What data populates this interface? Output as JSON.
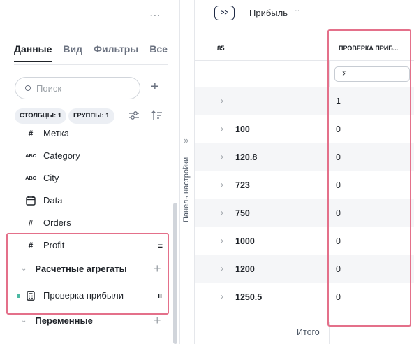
{
  "left_panel": {
    "more_label": "⋯",
    "tabs": [
      {
        "label": "Данные"
      },
      {
        "label": "Вид"
      },
      {
        "label": "Фильтры"
      },
      {
        "label": "Все"
      }
    ],
    "search": {
      "placeholder": "Поиск"
    },
    "chips": {
      "columns": "СТОЛБЦЫ: 1",
      "groups": "ГРУППЫ: 1"
    },
    "fields": [
      {
        "name": "Метка",
        "icon": "#"
      },
      {
        "name": "Category",
        "icon": "ABC"
      },
      {
        "name": "City",
        "icon": "ABC"
      },
      {
        "name": "Data",
        "icon": "calendar-icon"
      },
      {
        "name": "Orders",
        "icon": "#"
      },
      {
        "name": "Profit",
        "icon": "#"
      }
    ],
    "profit_marker": "=",
    "groups": {
      "aggregates_label": "Расчетные агрегаты",
      "variables_label": "Переменные"
    },
    "aggregate_field": {
      "name": "Проверка прибыли",
      "marker": "ıı"
    }
  },
  "settings_panel": {
    "label": "Панель настройки",
    "arrow": "»"
  },
  "report": {
    "toggle_label": ">>",
    "title": "Прибыль",
    "title_menu": "··",
    "header": {
      "row_header": "85",
      "column_header": "ПРОВЕРКА ПРИБ..."
    },
    "filter_value": "Σ",
    "rows": [
      {
        "key": "",
        "value": "1"
      },
      {
        "key": "100",
        "value": "0"
      },
      {
        "key": "120.8",
        "value": "0"
      },
      {
        "key": "723",
        "value": "0"
      },
      {
        "key": "750",
        "value": "0"
      },
      {
        "key": "1000",
        "value": "0"
      },
      {
        "key": "1200",
        "value": "0"
      },
      {
        "key": "1250.5",
        "value": "0"
      }
    ],
    "footer_label": "Итого"
  },
  "colors": {
    "highlight": "#e4708a",
    "accent": "#4cb9a3"
  }
}
